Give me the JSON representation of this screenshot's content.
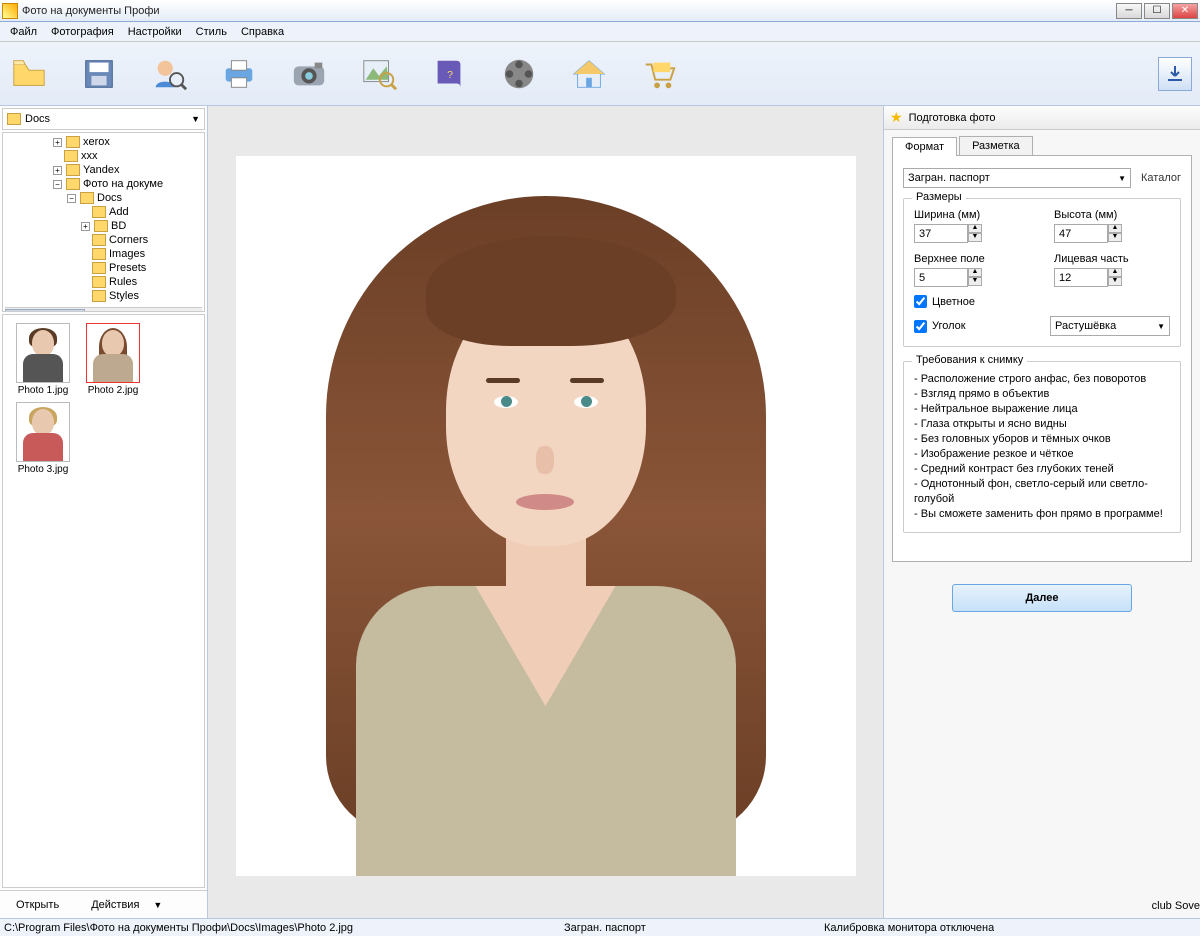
{
  "titlebar": {
    "title": "Фото на документы Профи"
  },
  "menu": {
    "file": "Файл",
    "photo": "Фотография",
    "settings": "Настройки",
    "style": "Стиль",
    "help": "Справка"
  },
  "left": {
    "combo": "Docs",
    "tree": {
      "n0": "xerox",
      "n1": "xxx",
      "n2": "Yandex",
      "n3": "Фото на докуме",
      "n4": "Docs",
      "n5": "Add",
      "n6": "BD",
      "n7": "Corners",
      "n8": "Images",
      "n9": "Presets",
      "n10": "Rules",
      "n11": "Styles"
    },
    "thumbs": {
      "t1": "Photo 1.jpg",
      "t2": "Photo 2.jpg",
      "t3": "Photo 3.jpg"
    },
    "open": "Открыть",
    "actions": "Действия"
  },
  "right": {
    "header": "Подготовка фото",
    "tab_format": "Формат",
    "tab_markup": "Разметка",
    "format_value": "Загран. паспорт",
    "catalog": "Каталог",
    "sizes_legend": "Размеры",
    "width_lbl": "Ширина (мм)",
    "width_val": "37",
    "height_lbl": "Высота (мм)",
    "height_val": "47",
    "top_lbl": "Верхнее поле",
    "top_val": "5",
    "face_lbl": "Лицевая часть",
    "face_val": "12",
    "color_lbl": "Цветное",
    "corner_lbl": "Уголок",
    "blur_value": "Растушёвка",
    "req_legend": "Требования к снимку",
    "req": {
      "r1": "Расположение строго анфас, без поворотов",
      "r2": "Взгляд прямо в объектив",
      "r3": "Нейтральное выражение лица",
      "r4": "Глаза открыты и ясно видны",
      "r5": "Без головных уборов и тёмных очков",
      "r6": "Изображение резкое и чёткое",
      "r7": "Средний контраст без глубоких теней",
      "r8": "Однотонный фон, светло-серый или светло-голубой",
      "r9": "Вы сможете заменить фон прямо в программе!"
    },
    "next": "Далее"
  },
  "status": {
    "path": "C:\\Program Files\\Фото на документы Профи\\Docs\\Images\\Photo 2.jpg",
    "format": "Загран. паспорт",
    "calib": "Калибровка монитора отключена"
  },
  "watermark": "club Sovet"
}
